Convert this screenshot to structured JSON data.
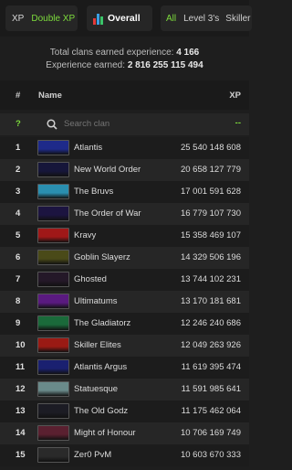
{
  "filters": {
    "xp_label": "XP",
    "double_xp_label": "Double XP",
    "overall_label": "Overall",
    "all_label": "All",
    "level3_label": "Level 3's",
    "skiller_label": "Skiller"
  },
  "summary": {
    "clans_label": "Total clans earned experience:",
    "clans_value": "4 166",
    "xp_label": "Experience earned:",
    "xp_value": "2 816 255 115 494"
  },
  "table": {
    "col_rank": "#",
    "col_name": "Name",
    "col_xp": "XP",
    "search_rank": "?",
    "search_placeholder": "Search clan",
    "search_xp": "--",
    "rows": [
      {
        "rank": "1",
        "name": "Atlantis",
        "xp": "25 540 148 608",
        "banner_color": "#1e2a8a"
      },
      {
        "rank": "2",
        "name": "New World Order",
        "xp": "20 658 127 779",
        "banner_color": "#16163a"
      },
      {
        "rank": "3",
        "name": "The Bruvs",
        "xp": "17 001 591 628",
        "banner_color": "#2a8fb0"
      },
      {
        "rank": "4",
        "name": "The Order of War",
        "xp": "16 779 107 730",
        "banner_color": "#1c1440"
      },
      {
        "rank": "5",
        "name": "Kravy",
        "xp": "15 358 469 107",
        "banner_color": "#a01818"
      },
      {
        "rank": "6",
        "name": "Goblin Slayerz",
        "xp": "14 329 506 196",
        "banner_color": "#4a4a18"
      },
      {
        "rank": "7",
        "name": "Ghosted",
        "xp": "13 744 102 231",
        "banner_color": "#241828"
      },
      {
        "rank": "8",
        "name": "Ultimatums",
        "xp": "13 170 181 681",
        "banner_color": "#5a1a80"
      },
      {
        "rank": "9",
        "name": "The Gladiatorz",
        "xp": "12 246 240 686",
        "banner_color": "#1a6a3a"
      },
      {
        "rank": "10",
        "name": "Skiller Elites",
        "xp": "12 049 263 926",
        "banner_color": "#9a1a14"
      },
      {
        "rank": "11",
        "name": "Atlantis Argus",
        "xp": "11 619 395 474",
        "banner_color": "#1a2070"
      },
      {
        "rank": "12",
        "name": "Statuesque",
        "xp": "11 591 985 641",
        "banner_color": "#6a8a8a"
      },
      {
        "rank": "13",
        "name": "The Old Godz",
        "xp": "11 175 462 064",
        "banner_color": "#1c1c24"
      },
      {
        "rank": "14",
        "name": "Might of Honour",
        "xp": "10 706 169 749",
        "banner_color": "#5a2030"
      },
      {
        "rank": "15",
        "name": "Zer0 PvM",
        "xp": "10 603 670 333",
        "banner_color": "#2a2a2a"
      }
    ]
  },
  "colors": {
    "accent_green": "#7ddc3c",
    "background": "#1e1e1e"
  }
}
